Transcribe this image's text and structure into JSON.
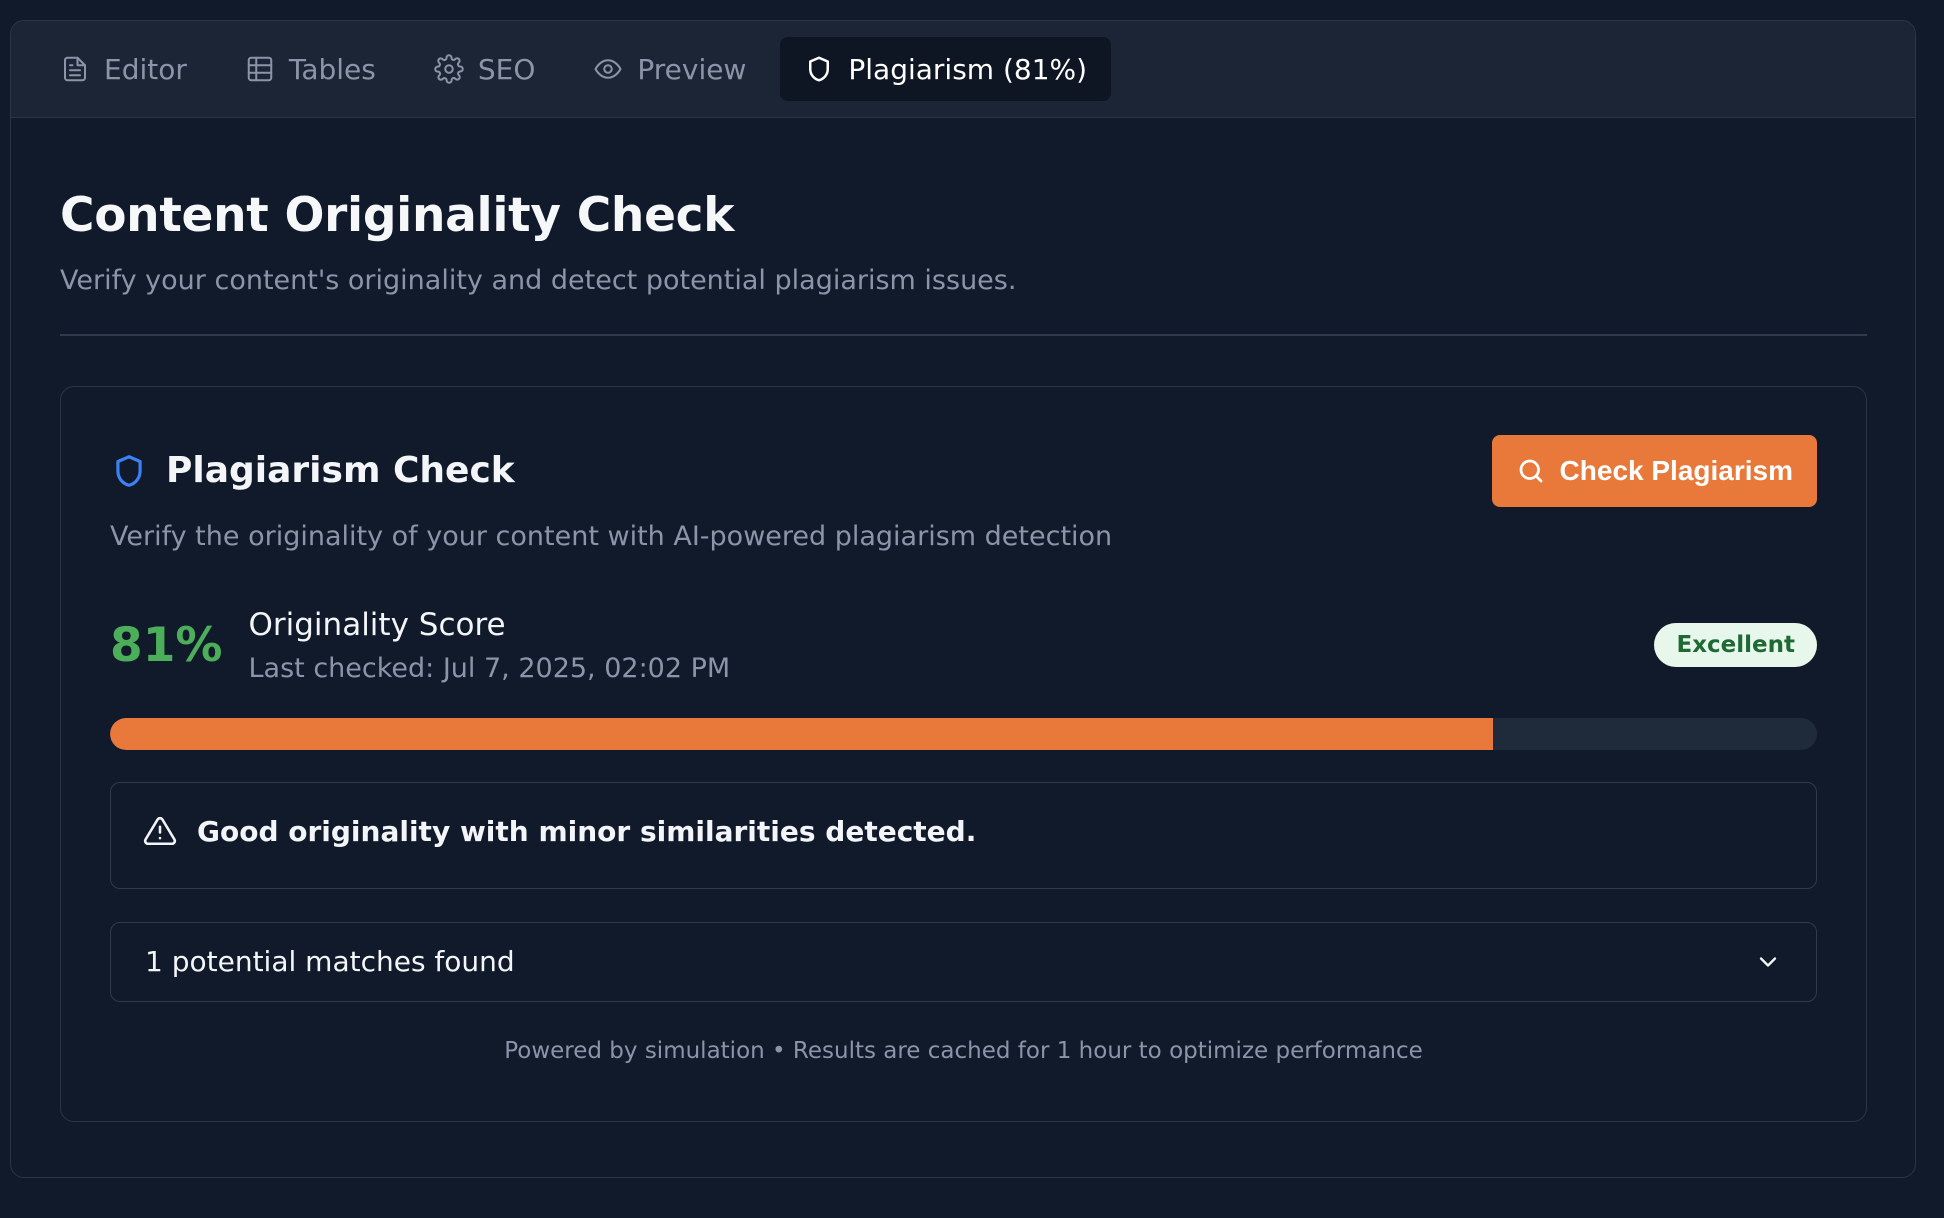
{
  "tabs": [
    {
      "label": "Editor",
      "icon": "document-icon"
    },
    {
      "label": "Tables",
      "icon": "table-icon"
    },
    {
      "label": "SEO",
      "icon": "gear-icon"
    },
    {
      "label": "Preview",
      "icon": "eye-icon"
    },
    {
      "label": "Plagiarism (81%)",
      "icon": "shield-icon",
      "active": true
    }
  ],
  "page": {
    "title": "Content Originality Check",
    "subtitle": "Verify your content's originality and detect potential plagiarism issues."
  },
  "card": {
    "title": "Plagiarism Check",
    "subtitle": "Verify the originality of your content with AI-powered plagiarism detection",
    "check_button": "Check Plagiarism"
  },
  "score": {
    "percent_label": "81%",
    "percent_value": 0.81,
    "label": "Originality Score",
    "last_checked": "Last checked: Jul 7, 2025, 02:02 PM",
    "badge": "Excellent"
  },
  "alert": {
    "message": "Good originality with minor similarities detected."
  },
  "matches": {
    "label": "1 potential matches found"
  },
  "footer": {
    "note": "Powered by simulation • Results are cached for 1 hour to optimize performance"
  },
  "colors": {
    "accent": "#e8793a",
    "score_green": "#4cae5b",
    "shield_blue": "#3b82f6",
    "badge_bg": "#e8f7ec"
  }
}
